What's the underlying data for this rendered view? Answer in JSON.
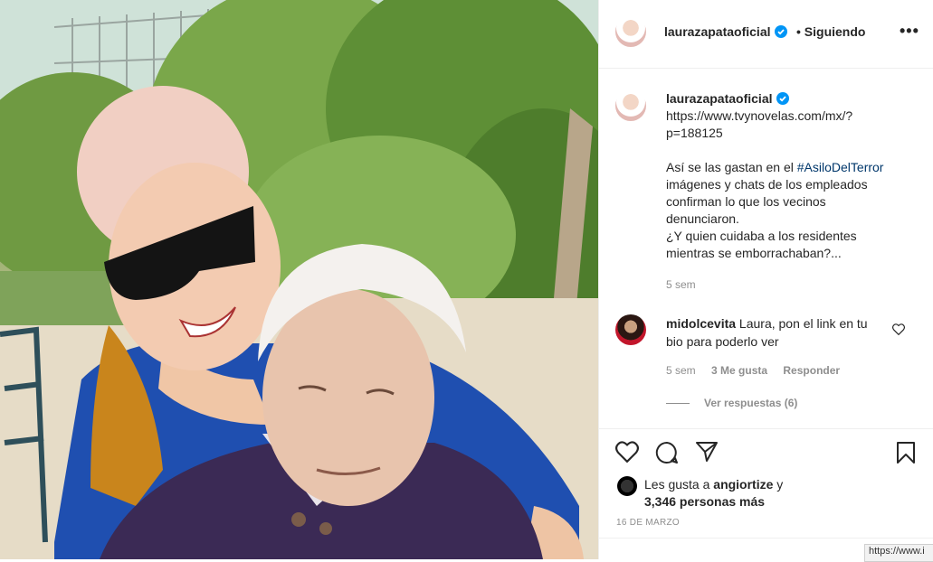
{
  "post": {
    "author": "laurazapataoficial",
    "verified": true,
    "follow_status": "Siguiendo",
    "more_icon": "more-horizontal-icon"
  },
  "caption": {
    "username": "laurazapataoficial",
    "lines": [
      "https://www.tvynovelas.com/mx/?",
      "p=188125",
      "",
      "Así se las gastan en el ",
      "#AsiloDelTerror",
      "imágenes y chats de los empleados",
      "confirman lo que los vecinos",
      "denunciaron.",
      "¿Y quien cuidaba a los residentes",
      "mientras se emborrachaban?..."
    ],
    "time": "5 sem"
  },
  "comment": {
    "username": "midolcevita",
    "text": "Laura, pon el link en tu bio para poderlo ver",
    "time": "5 sem",
    "likes": "3 Me gusta",
    "reply": "Responder",
    "view_replies": "Ver respuestas (6)"
  },
  "likes": {
    "prefix": "Les gusta a ",
    "user": "angiortize",
    "suffix": " y",
    "others": "3,346 personas más"
  },
  "date": "16 DE MARZO",
  "status_url": "https://www.i",
  "colors": {
    "verified": "#0095f6",
    "hashtag": "#00376b",
    "meta": "#8e8e8e"
  }
}
